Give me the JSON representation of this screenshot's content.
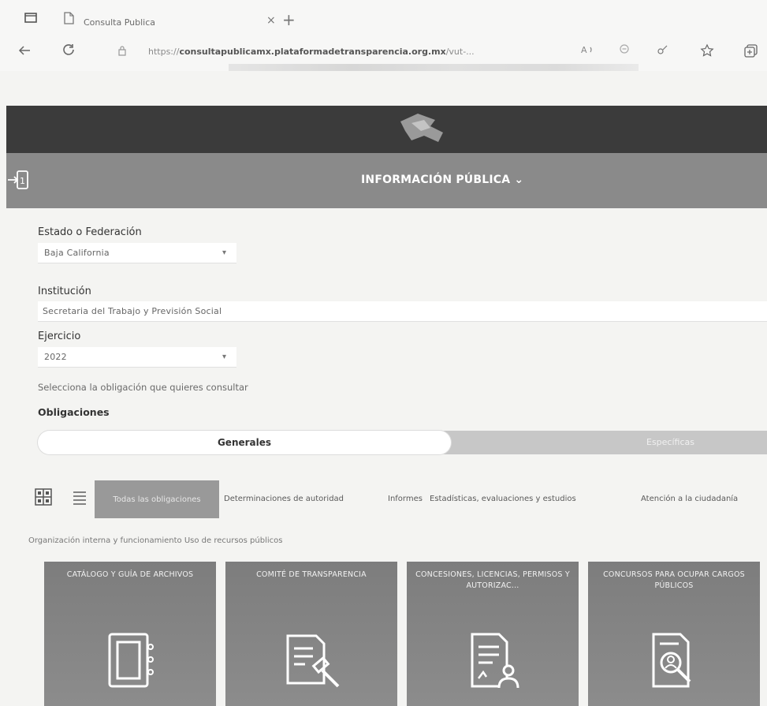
{
  "browser": {
    "tab_title": "Consulta Publica",
    "url_prefix": "https://",
    "url_domain": "consultapublicamx.plataformadetransparencia.org.mx",
    "url_suffix": "/vut-...",
    "close_glyph": "×",
    "new_tab_glyph": "+",
    "icons": [
      "tab-actions-icon",
      "page-icon",
      "back-arrow-icon",
      "reload-icon",
      "site-info-icon",
      "read-aloud-icon",
      "zoom-icon",
      "favorites-star-icon",
      "collections-icon"
    ]
  },
  "header": {
    "menu_title": "INFORMACIÓN PÚBLICA",
    "menu_caret": "⌄",
    "logo": "logo-icon"
  },
  "form": {
    "estado_label": "Estado o Federación",
    "estado_value": "Baja California",
    "institucion_label": "Institución",
    "institucion_value": "Secretaria del Trabajo y Previsión Social",
    "ejercicio_label": "Ejercicio",
    "ejercicio_value": "2022",
    "hint": "Selecciona la obligación que quieres consultar",
    "obligaciones_label": "Obligaciones"
  },
  "toggle": {
    "generales": "Generales",
    "especificas": "Específicas"
  },
  "filters": {
    "active": "Todas las obligaciones",
    "items": [
      "Determinaciones de autoridad",
      "Informes",
      "Estadísticas, evaluaciones y estudios",
      "Atención a la ciudadanía"
    ],
    "second_row": "Organización interna y funcionamiento  Uso de recursos públicos"
  },
  "cards": [
    {
      "title": "CATÁLOGO Y GUÍA DE ARCHIVOS",
      "icon": "archive-binder-icon"
    },
    {
      "title": "COMITÉ DE TRANSPARENCIA",
      "icon": "document-gavel-icon"
    },
    {
      "title": "CONCESIONES, LICENCIAS, PERMISOS Y AUTORIZAC...",
      "icon": "document-user-icon"
    },
    {
      "title": "CONCURSOS PARA OCUPAR CARGOS PÚBLICOS",
      "icon": "document-search-icon"
    }
  ],
  "colors": {
    "logo_band": "#3b3b3b",
    "menu_band": "#8a8a8a",
    "card_bg": "#7d7d7d",
    "toggle_off": "#c7c7c7"
  }
}
